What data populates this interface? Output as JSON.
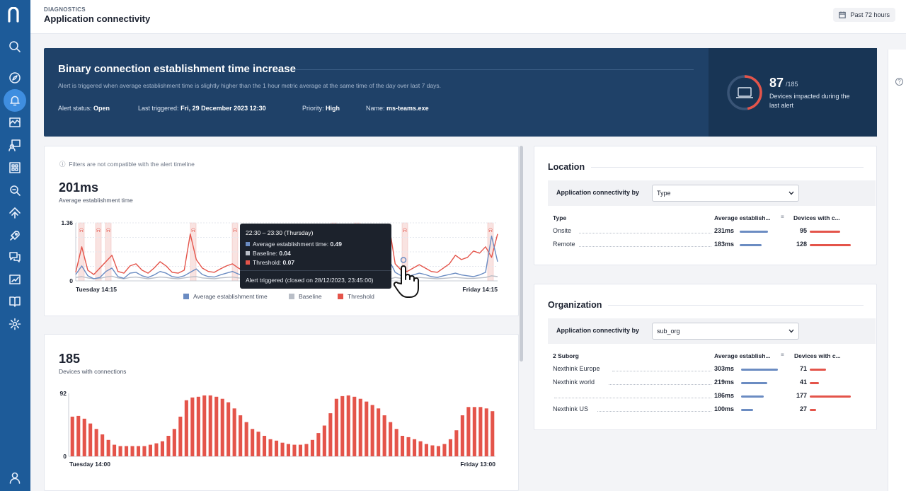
{
  "header": {
    "breadcrumb": "DIAGNOSTICS",
    "title": "Application connectivity",
    "timeframe": "Past 72 hours"
  },
  "alert": {
    "title": "Binary connection establishment time increase",
    "description": "Alert is triggered when average establishment time is slightly higher than the 1 hour metric average at the same time of the day over last 7 days.",
    "status_label": "Alert status:",
    "status": "Open",
    "last_triggered_label": "Last triggered:",
    "last_triggered": "Fri, 29 December 2023 12:30",
    "priority_label": "Priority:",
    "priority": "High",
    "name_label": "Name:",
    "name": "ms-teams.exe",
    "impacted": "87",
    "impacted_total": "/185",
    "impacted_text": "Devices impacted during the last alert",
    "impacted_fraction": 0.47
  },
  "timeline_card": {
    "filter_note": "Filters are not compatible with the alert timeline",
    "metric": "201ms",
    "metric_label": "Average establishment time",
    "y_max_label": "1.36",
    "y_min_label": "0",
    "x_start_label": "Tuesday 14:15",
    "x_end_label": "Friday 14:15",
    "legend": [
      "Average establishment time",
      "Baseline",
      "Threshold"
    ],
    "colors": {
      "average": "#6b8cc2",
      "baseline": "#b9bec7",
      "threshold": "#e4544a"
    }
  },
  "tooltip": {
    "header": "22:30 – 23:30 (Thursday)",
    "rows": [
      {
        "label": "Average establishment time:",
        "value": "0.49"
      },
      {
        "label": "Baseline:",
        "value": "0.04"
      },
      {
        "label": "Threshold:",
        "value": "0.07"
      }
    ],
    "footer": "Alert triggered (closed on 28/12/2023, 23:45:00)"
  },
  "devices_card": {
    "metric": "185",
    "metric_label": "Devices with connections",
    "y_max_label": "92",
    "y_min_label": "0",
    "x_start_label": "Tuesday 14:00",
    "x_end_label": "Friday 13:00"
  },
  "chart_data": [
    {
      "type": "line",
      "title": "",
      "ylim": [
        0,
        1.36
      ],
      "x_range": [
        "Tuesday 14:15",
        "Friday 14:15"
      ],
      "series": [
        {
          "name": "Average establishment time",
          "values": [
            0.15,
            0.35,
            0.12,
            0.05,
            0.08,
            0.22,
            0.3,
            0.1,
            0.06,
            0.18,
            0.2,
            0.12,
            0.08,
            0.14,
            0.22,
            0.18,
            0.1,
            0.08,
            0.12,
            0.2,
            0.28,
            0.15,
            0.1,
            0.09,
            0.14,
            0.18,
            0.22,
            0.16,
            0.1,
            0.08,
            0.12,
            0.19,
            0.25,
            0.3,
            0.18,
            0.1,
            0.09,
            0.12,
            0.16,
            0.12,
            0.18,
            0.22,
            0.15,
            0.11,
            0.09,
            0.14,
            0.2,
            0.26,
            0.18,
            0.12,
            0.08,
            0.1,
            0.49,
            0.2,
            0.12,
            0.1,
            0.14,
            0.18,
            0.15,
            0.1,
            0.08,
            0.12,
            0.15,
            0.18,
            0.14,
            0.12,
            0.1,
            0.14,
            0.2,
            1.05,
            0.45
          ]
        },
        {
          "name": "Threshold",
          "values": [
            0.2,
            0.8,
            0.25,
            0.15,
            0.3,
            0.45,
            0.6,
            0.22,
            0.18,
            0.35,
            0.4,
            0.25,
            0.18,
            0.3,
            0.45,
            0.35,
            0.2,
            0.18,
            0.25,
            1.1,
            0.5,
            0.3,
            0.22,
            0.2,
            0.28,
            0.35,
            0.4,
            0.3,
            0.22,
            0.2,
            0.3,
            0.35,
            0.55,
            0.6,
            0.35,
            0.22,
            0.2,
            0.25,
            0.3,
            0.25,
            0.35,
            0.45,
            0.3,
            0.22,
            0.2,
            0.28,
            0.4,
            0.5,
            0.35,
            0.25,
            0.2,
            0.3,
            1.3,
            0.4,
            0.25,
            0.22,
            0.3,
            0.38,
            0.3,
            0.22,
            0.2,
            0.3,
            0.4,
            0.6,
            0.5,
            0.55,
            0.7,
            0.65,
            0.8,
            0.55,
            1.1
          ]
        },
        {
          "name": "Baseline",
          "values": [
            0.08,
            0.1,
            0.07,
            0.05,
            0.06,
            0.09,
            0.11,
            0.07,
            0.05,
            0.08,
            0.09,
            0.07,
            0.05,
            0.07,
            0.09,
            0.08,
            0.06,
            0.05,
            0.07,
            0.09,
            0.1,
            0.07,
            0.06,
            0.05,
            0.07,
            0.08,
            0.09,
            0.07,
            0.06,
            0.05,
            0.07,
            0.08,
            0.1,
            0.11,
            0.08,
            0.06,
            0.05,
            0.07,
            0.08,
            0.06,
            0.08,
            0.09,
            0.07,
            0.06,
            0.05,
            0.07,
            0.08,
            0.1,
            0.08,
            0.06,
            0.05,
            0.06,
            0.04,
            0.08,
            0.06,
            0.05,
            0.07,
            0.08,
            0.07,
            0.06,
            0.05,
            0.06,
            0.07,
            0.08,
            0.07,
            0.06,
            0.06,
            0.07,
            0.08,
            0.12,
            0.1
          ]
        }
      ]
    },
    {
      "type": "bar",
      "title": "",
      "ylim": [
        0,
        92
      ],
      "x_range": [
        "Tuesday 14:00",
        "Friday 13:00"
      ],
      "series": [
        {
          "name": "Devices with connections",
          "values": [
            58,
            59,
            55,
            48,
            40,
            32,
            24,
            17,
            15,
            15,
            15,
            15,
            15,
            17,
            19,
            22,
            30,
            40,
            58,
            82,
            86,
            87,
            89,
            89,
            87,
            84,
            79,
            70,
            60,
            50,
            40,
            36,
            30,
            25,
            23,
            20,
            18,
            17,
            17,
            18,
            24,
            34,
            45,
            63,
            84,
            88,
            89,
            87,
            84,
            80,
            75,
            70,
            60,
            50,
            40,
            30,
            28,
            25,
            22,
            18,
            16,
            15,
            18,
            25,
            38,
            60,
            72,
            72,
            72,
            70,
            66
          ]
        }
      ]
    }
  ],
  "location": {
    "title": "Location",
    "connectivity_by_label": "Application connectivity by",
    "selected": "Type",
    "columns": [
      "Type",
      "Average establish...",
      "Devices with c..."
    ],
    "rows": [
      {
        "name": "Onsite",
        "avg": "231ms",
        "avg_frac": 0.76,
        "devices": "95",
        "dev_frac": 0.74
      },
      {
        "name": "Remote",
        "avg": "183ms",
        "avg_frac": 0.6,
        "devices": "128",
        "dev_frac": 1.0
      }
    ]
  },
  "organization": {
    "title": "Organization",
    "connectivity_by_label": "Application connectivity by",
    "selected": "sub_org",
    "columns": [
      "2 Suborg",
      "Average establish...",
      "Devices with c..."
    ],
    "rows": [
      {
        "name": "Nexthink Europe",
        "avg": "303ms",
        "avg_frac": 1.0,
        "devices": "71",
        "dev_frac": 0.4
      },
      {
        "name": "Nexthink world",
        "avg": "219ms",
        "avg_frac": 0.72,
        "devices": "41",
        "dev_frac": 0.23
      },
      {
        "name": "",
        "avg": "186ms",
        "avg_frac": 0.61,
        "devices": "177",
        "dev_frac": 1.0
      },
      {
        "name": "Nexthink US",
        "avg": "100ms",
        "avg_frac": 0.33,
        "devices": "27",
        "dev_frac": 0.15
      }
    ]
  }
}
